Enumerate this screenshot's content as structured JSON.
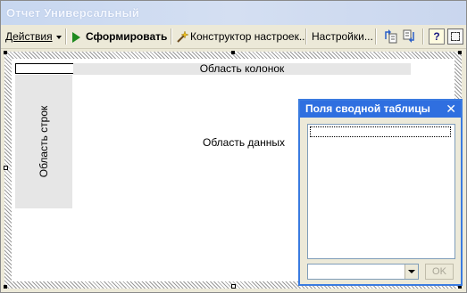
{
  "window": {
    "title": "Отчет  Универсальный"
  },
  "toolbar": {
    "actions_label": "Действия",
    "generate_label": "Сформировать",
    "constructor_label": "Конструктор настроек...",
    "settings_label": "Настройки...",
    "help_label": "?"
  },
  "report": {
    "columns_area_label": "Область колонок",
    "rows_area_label": "Область строк",
    "data_area_label": "Область данных"
  },
  "pivot_panel": {
    "title": "Поля сводной таблицы",
    "close_label": "✕",
    "combo_value": "",
    "ok_label": "OK"
  },
  "colors": {
    "panel_title_bg": "#2f6fe0",
    "area_bg": "#e6e6e6",
    "generate_icon": "#1f8a1f"
  }
}
